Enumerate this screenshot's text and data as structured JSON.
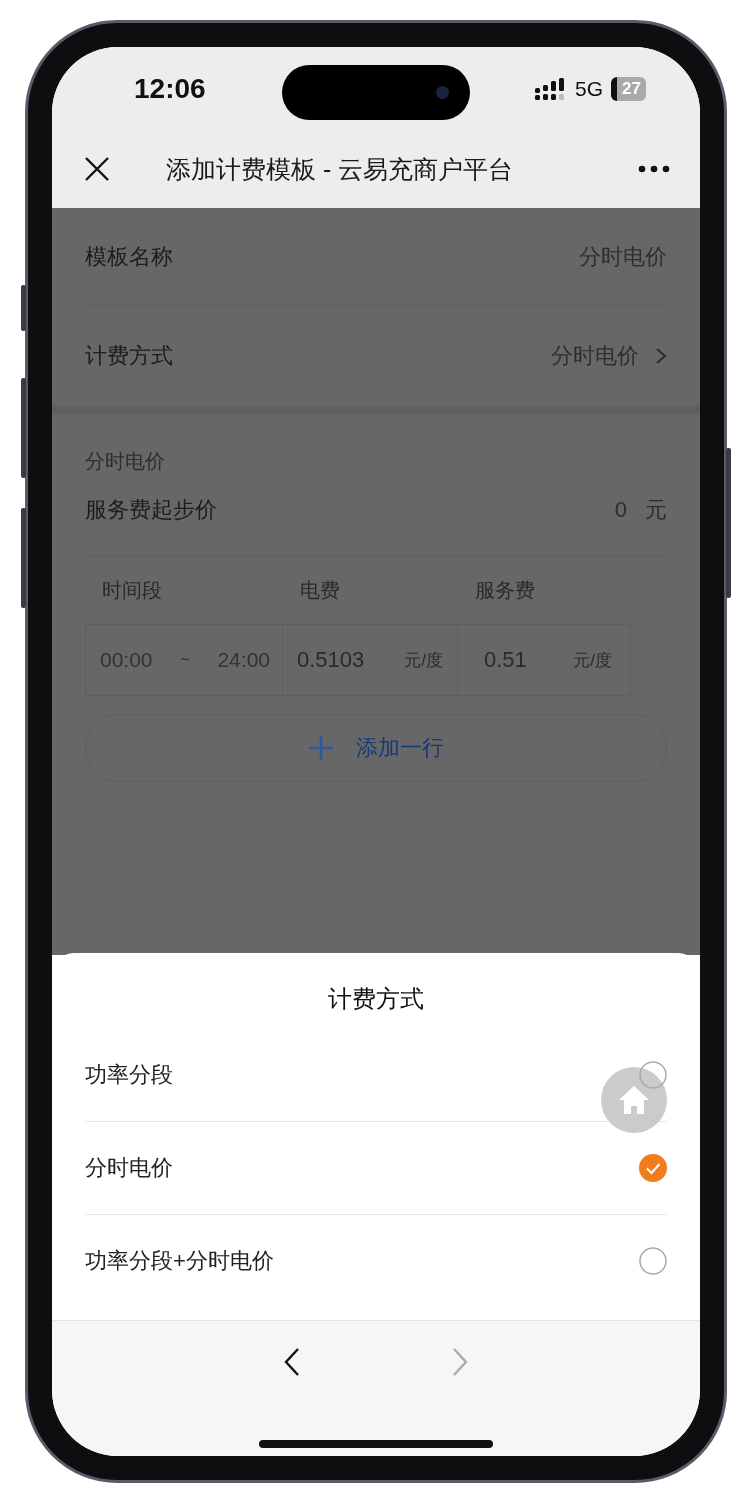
{
  "status_bar": {
    "time": "12:06",
    "network": "5G",
    "battery": "27"
  },
  "nav": {
    "title": "添加计费模板 - 云易充商户平台"
  },
  "form": [
    {
      "kind": "text",
      "label": "模板名称",
      "value": "分时电价"
    },
    {
      "kind": "select",
      "label": "计费方式",
      "value": "分时电价"
    }
  ],
  "section": {
    "title": "分时电价",
    "start_fee": {
      "label": "服务费起步价",
      "value": "0",
      "unit": "元"
    }
  },
  "table": {
    "columns": [
      "时间段",
      "电费",
      "服务费"
    ],
    "rows": [
      {
        "start": "00:00",
        "separator": "~",
        "end": "24:00",
        "power_price": "0.5103",
        "power_unit": "元/度",
        "service_price": "0.51",
        "service_unit": "元/度"
      }
    ]
  },
  "add_row": {
    "label": "添加一行"
  },
  "sheet": {
    "title": "计费方式",
    "options": [
      {
        "label": "功率分段",
        "selected": false
      },
      {
        "label": "分时电价",
        "selected": true
      },
      {
        "label": "功率分段+分时电价",
        "selected": false
      }
    ]
  },
  "toolbar": {
    "back": {
      "disabled": false
    },
    "forward": {
      "disabled": true
    }
  }
}
